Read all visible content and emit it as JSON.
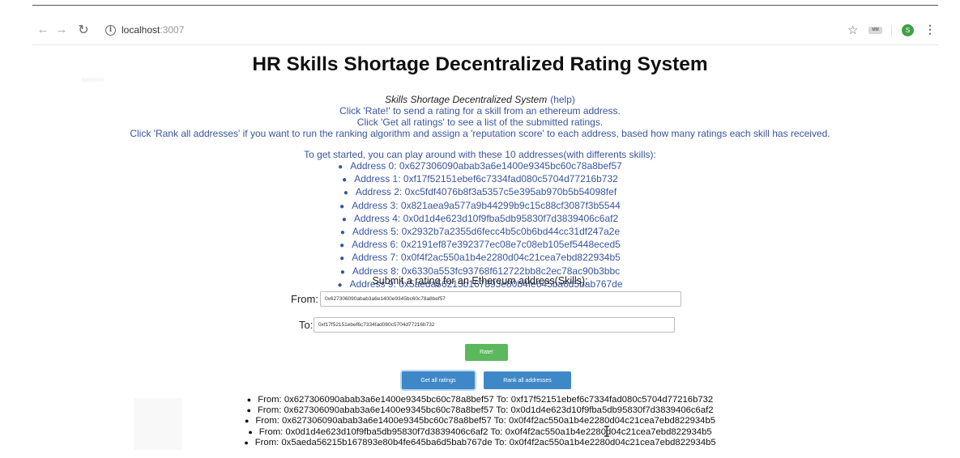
{
  "browser": {
    "url_host": "localhost",
    "url_port": ":3007",
    "avatar_letter": "S",
    "extension_label": "MM",
    "icons": [
      "back-arrow-icon",
      "forward-arrow-icon",
      "reload-icon",
      "info-icon",
      "star-icon",
      "extension-icon",
      "profile-avatar-icon",
      "menu-dots-icon"
    ]
  },
  "page": {
    "title": "HR Skills Shortage Decentralized Rating System",
    "intro": {
      "system_name": "Skills Shortage Decentralized System",
      "help_link": "(help)",
      "lines": [
        "Click 'Rate!' to send a rating for a skill from an ethereum address.",
        "Click 'Get all ratings' to see a list of the submitted ratings.",
        "Click 'Rank all addresses' if you want to run the ranking algorithm and assign a 'reputation score' to each address, based how many ratings each skill has received."
      ]
    },
    "started_text": "To get started, you can play around with these 10 addresses(with differents skills):",
    "addresses": [
      "Address 0: 0x627306090abab3a6e1400e9345bc60c78a8bef57",
      "Address 1: 0xf17f52151ebef6c7334fad080c5704d77216b732",
      "Address 2: 0xc5fdf4076b8f3a5357c5e395ab970b5b54098fef",
      "Address 3: 0x821aea9a577a9b44299b9c15c88cf3087f3b5544",
      "Address 4: 0x0d1d4e623d10f9fba5db95830f7d3839406c6af2",
      "Address 5: 0x2932b7a2355d6fecc4b5c0b6bd44cc31df247a2e",
      "Address 6: 0x2191ef87e392377ec08e7c08eb105ef5448eced5",
      "Address 7: 0x0f4f2ac550a1b4e2280d04c21cea7ebd822934b5",
      "Address 8: 0x6330a553fc93768f612722bb8c2ec78ac90b3bbc",
      "Address 9: 0x5aeda56215b167893e80b4fe645ba6d5bab767de"
    ],
    "submit_heading": "Submit a rating for an Ethereum address(Skills):",
    "form": {
      "from_label": "From:",
      "from_value": "0x627306090abab3a6e1400e9345bc60c78a8bef57",
      "to_label": "To:",
      "to_value": "0xf17f52151ebef6c7334fad080c5704d77216b732",
      "rate_button": "Rate!",
      "get_all_button": "Get all ratings",
      "rank_button": "Rank all addresses"
    },
    "ratings": [
      "From: 0x627306090abab3a6e1400e9345bc60c78a8bef57 To: 0xf17f52151ebef6c7334fad080c5704d77216b732",
      "From: 0x627306090abab3a6e1400e9345bc60c78a8bef57 To: 0x0d1d4e623d10f9fba5db95830f7d3839406c6af2",
      "From: 0x627306090abab3a6e1400e9345bc60c78a8bef57 To: 0x0f4f2ac550a1b4e2280d04c21cea7ebd822934b5",
      "From: 0x0d1d4e623d10f9fba5db95830f7d3839406c6af2 To: 0x0f4f2ac550a1b4e2280d04c21cea7ebd822934b5",
      "From: 0x5aeda56215b167893e80b4fe645ba6d5bab767de To: 0x0f4f2ac550a1b4e2280d04c21cea7ebd822934b5"
    ]
  },
  "colors": {
    "link_blue": "#3a55a0",
    "rate_green": "#5cb85c",
    "action_blue": "#3f88c8",
    "avatar_green": "#43a047"
  }
}
